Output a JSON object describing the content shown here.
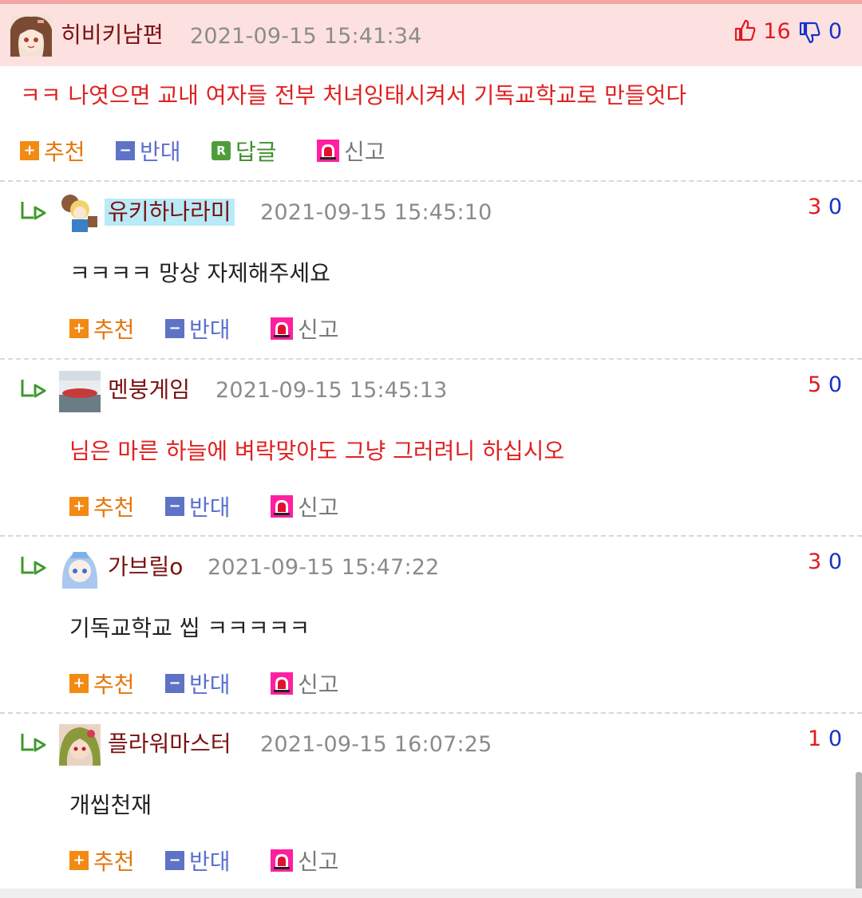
{
  "main_comment": {
    "author": "히비키남편",
    "time": "2021-09-15 15:41:34",
    "likes": "16",
    "dislikes": "0",
    "text": "ㅋㅋ 나엿으면 교내 여자들 전부 처녀잉태시켜서 기독교학교로 만들엇다",
    "actions": {
      "up": "추천",
      "down": "반대",
      "reply": "답글",
      "report": "신고"
    }
  },
  "replies": [
    {
      "author": "유키하나라미",
      "time": "2021-09-15 15:45:10",
      "up": "3",
      "down": "0",
      "text": "ㅋㅋㅋㅋ 망상 자제해주세요",
      "up_label": "추천",
      "down_label": "반대",
      "report_label": "신고"
    },
    {
      "author": "멘붕게임",
      "time": "2021-09-15 15:45:13",
      "up": "5",
      "down": "0",
      "text": "님은 마른 하늘에 벼락맞아도 그냥 그러려니 하십시오",
      "up_label": "추천",
      "down_label": "반대",
      "report_label": "신고"
    },
    {
      "author": "가브릴o",
      "time": "2021-09-15 15:47:22",
      "up": "3",
      "down": "0",
      "text": "기독교학교 씹 ㅋㅋㅋㅋㅋ",
      "up_label": "추천",
      "down_label": "반대",
      "report_label": "신고"
    },
    {
      "author": "플라워마스터",
      "time": "2021-09-15 16:07:25",
      "up": "1",
      "down": "0",
      "text": "개씹천재",
      "up_label": "추천",
      "down_label": "반대",
      "report_label": "신고"
    }
  ],
  "colors": {
    "main_bg": "#fde1e1",
    "red_text": "#e02020",
    "nick": "#7a1010",
    "up": "#e5760c",
    "down": "#5a6fcf",
    "reply": "#3f8f2f",
    "highlight": "#b9eaf7"
  },
  "icons": {
    "like": "thumbs-up-icon",
    "dislike": "thumbs-down-icon",
    "plus": "plus-icon",
    "minus": "minus-icon",
    "reply": "reply-icon",
    "report": "siren-icon",
    "reply_arrow": "reply-arrow-icon"
  }
}
